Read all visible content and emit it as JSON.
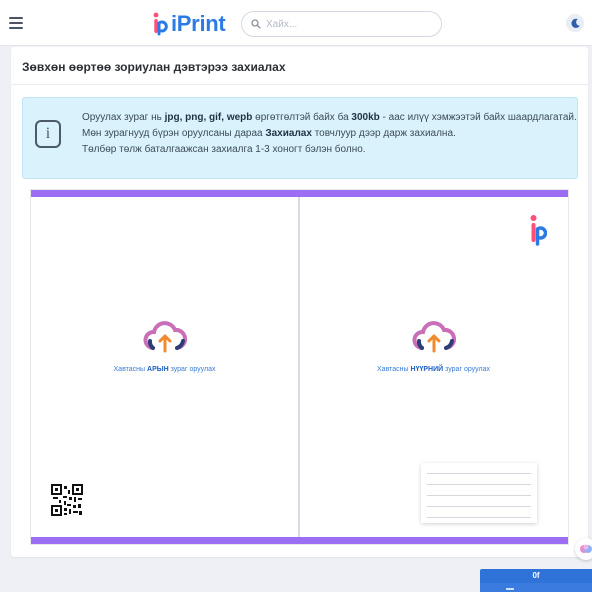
{
  "header": {
    "brand": "iPrint",
    "search_placeholder": "Хайх..."
  },
  "page": {
    "title": "Зөвхөн өөртөө зориулан дэвтэрээ захиалах"
  },
  "notice": {
    "line1_a": "Оруулах зураг нь ",
    "formats": "jpg, png, gif, wepb",
    "line1_b": " өргөтгөлтэй байх ба ",
    "size": "300kb",
    "line1_c": " - аас илүү хэмжээтэй байх шаардлагатай.",
    "line2_a": "Мөн зурагнууд бүрэн оруулсаны дараа ",
    "action": "Захиалах",
    "line2_b": " товчлуур дээр дарж захиална.",
    "line3": "Төлбөр төлж баталгаажсан захиалга 1-3 хоногт бэлэн болно."
  },
  "cover": {
    "back_label_a": "Хавтасны ",
    "back_label_b": "АРЫН",
    "back_label_c": " зураг оруулах",
    "front_label_a": "Хавтасны ",
    "front_label_b": "НҮҮРНИЙ",
    "front_label_c": " зураг оруулах"
  },
  "floating": {
    "chip_text": "0f"
  },
  "colors": {
    "brand": "#2c7be5",
    "cover_border": "#9b6ef3",
    "notice_bg": "#d9f2fb"
  },
  "icons": [
    "hamburger-icon",
    "search-icon",
    "moon-icon",
    "info-icon",
    "cloud-upload-icon",
    "qr-code-icon",
    "brand-logo-icon",
    "brain-icon"
  ]
}
